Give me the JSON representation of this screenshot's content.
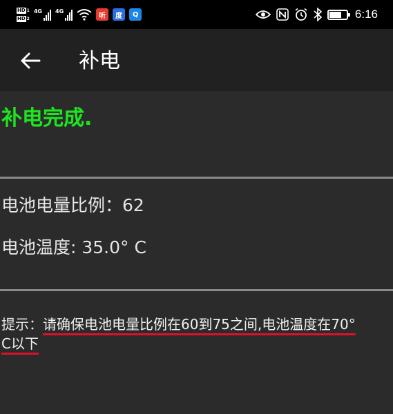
{
  "status_bar": {
    "sim1": "HD",
    "sim2": "HD",
    "network1": "4G",
    "network2": "4G",
    "app_icons": [
      "听",
      "度",
      "Q"
    ],
    "time": "6:16",
    "battery_level": 0.7
  },
  "toolbar": {
    "title": "补电"
  },
  "main": {
    "status_message": "补电完成.",
    "battery_level_label": "电池电量比例：62",
    "battery_temp_label": "电池温度: 35.0° C",
    "hint_label": "提示：",
    "hint_text_line1": "请确保电池电量比例在60到75之间,电池温度在70°",
    "hint_text_line2": "C以下"
  },
  "colors": {
    "background": "#2b2b2b",
    "toolbar": "#212121",
    "success": "#1ee61e",
    "underline": "#e0102a"
  }
}
